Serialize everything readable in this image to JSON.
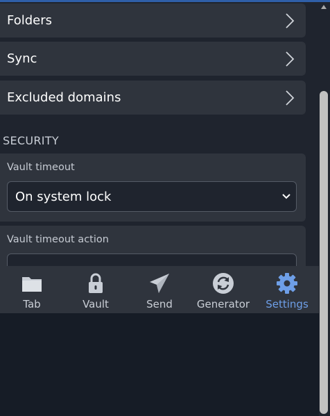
{
  "settings": {
    "rows": [
      {
        "label": "Folders"
      },
      {
        "label": "Sync"
      },
      {
        "label": "Excluded domains"
      }
    ],
    "security_title": "SECURITY",
    "vault_timeout": {
      "label": "Vault timeout",
      "value": "On system lock"
    },
    "vault_timeout_action": {
      "label": "Vault timeout action"
    }
  },
  "tabs": [
    {
      "label": "Tab",
      "icon": "folder-icon",
      "active": false
    },
    {
      "label": "Vault",
      "icon": "lock-icon",
      "active": false
    },
    {
      "label": "Send",
      "icon": "paper-plane-icon",
      "active": false
    },
    {
      "label": "Generator",
      "icon": "refresh-icon",
      "active": false
    },
    {
      "label": "Settings",
      "icon": "gear-icon",
      "active": true
    }
  ],
  "colors": {
    "accent": "#6e9fe8",
    "panel": "#2f343d",
    "background": "#1f242e"
  }
}
